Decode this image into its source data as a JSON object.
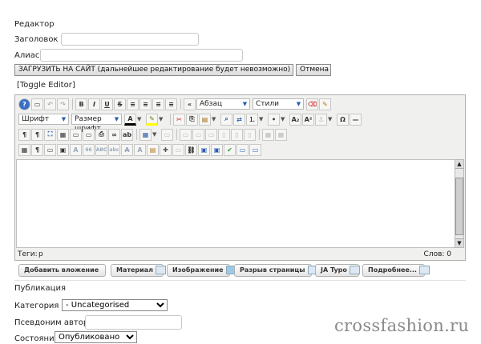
{
  "section_title": "Редактор",
  "title_field": {
    "label": "Заголовок *",
    "value": ""
  },
  "alias_field": {
    "label": "Алиас",
    "value": ""
  },
  "upload_button": "ЗАГРУЗИТЬ НА САЙТ (дальнейшее редактирование будет невозможно)",
  "cancel_button": "Отмена",
  "toggle_editor": "[Toggle Editor]",
  "toolbar": {
    "format_select": "Абзац",
    "styles_select": "Стили",
    "font_select": "Шрифт",
    "size_select": "Размер шрифт",
    "bold": "B",
    "italic": "I",
    "underline": "U",
    "strike": "S"
  },
  "status_bar": {
    "path_label": "Теги:",
    "path_value": "p",
    "word_count": "Слов: 0"
  },
  "extra_buttons": {
    "add_attachment": "Добавить вложение",
    "article": "Материал",
    "image": "Изображение",
    "page_break": "Разрыв страницы",
    "ja_typo": "JA Typo",
    "readmore": "Подробнее..."
  },
  "publishing_title": "Публикация",
  "category": {
    "label": "Категория *",
    "value": "- Uncategorised"
  },
  "author_alias": {
    "label": "Псевдоним автора",
    "value": ""
  },
  "state": {
    "label": "Состояние",
    "value": "Опубликовано"
  },
  "watermark": "crossfashion.ru"
}
